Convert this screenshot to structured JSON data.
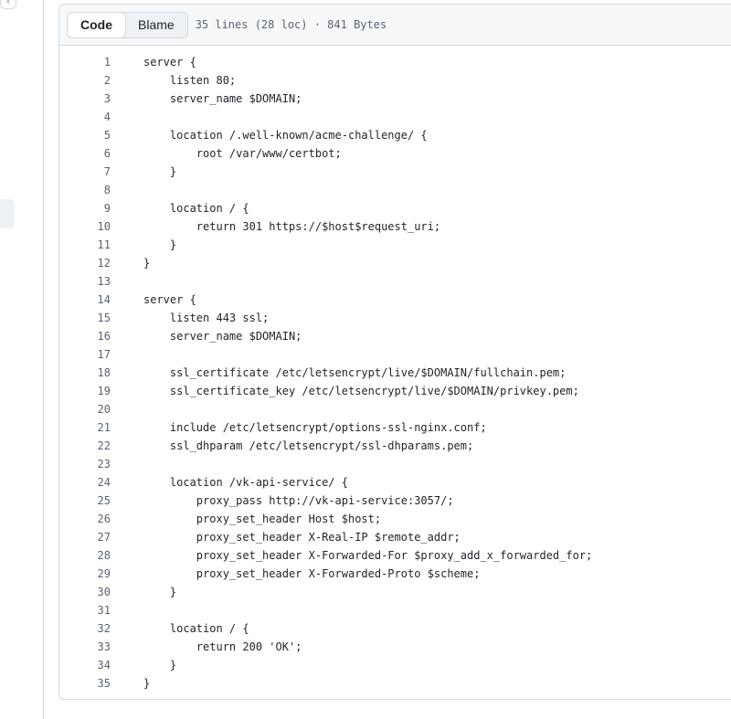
{
  "toolbar": {
    "code_label": "Code",
    "blame_label": "Blame",
    "file_info": "35 lines (28 loc) · 841 Bytes"
  },
  "code": {
    "lines": [
      {
        "num": "1",
        "text": "server {"
      },
      {
        "num": "2",
        "text": "    listen 80;"
      },
      {
        "num": "3",
        "text": "    server_name $DOMAIN;"
      },
      {
        "num": "4",
        "text": ""
      },
      {
        "num": "5",
        "text": "    location /.well-known/acme-challenge/ {"
      },
      {
        "num": "6",
        "text": "        root /var/www/certbot;"
      },
      {
        "num": "7",
        "text": "    }"
      },
      {
        "num": "8",
        "text": ""
      },
      {
        "num": "9",
        "text": "    location / {"
      },
      {
        "num": "10",
        "text": "        return 301 https://$host$request_uri;"
      },
      {
        "num": "11",
        "text": "    }"
      },
      {
        "num": "12",
        "text": "}"
      },
      {
        "num": "13",
        "text": ""
      },
      {
        "num": "14",
        "text": "server {"
      },
      {
        "num": "15",
        "text": "    listen 443 ssl;"
      },
      {
        "num": "16",
        "text": "    server_name $DOMAIN;"
      },
      {
        "num": "17",
        "text": ""
      },
      {
        "num": "18",
        "text": "    ssl_certificate /etc/letsencrypt/live/$DOMAIN/fullchain.pem;"
      },
      {
        "num": "19",
        "text": "    ssl_certificate_key /etc/letsencrypt/live/$DOMAIN/privkey.pem;"
      },
      {
        "num": "20",
        "text": ""
      },
      {
        "num": "21",
        "text": "    include /etc/letsencrypt/options-ssl-nginx.conf;"
      },
      {
        "num": "22",
        "text": "    ssl_dhparam /etc/letsencrypt/ssl-dhparams.pem;"
      },
      {
        "num": "23",
        "text": ""
      },
      {
        "num": "24",
        "text": "    location /vk-api-service/ {"
      },
      {
        "num": "25",
        "text": "        proxy_pass http://vk-api-service:3057/;"
      },
      {
        "num": "26",
        "text": "        proxy_set_header Host $host;"
      },
      {
        "num": "27",
        "text": "        proxy_set_header X-Real-IP $remote_addr;"
      },
      {
        "num": "28",
        "text": "        proxy_set_header X-Forwarded-For $proxy_add_x_forwarded_for;"
      },
      {
        "num": "29",
        "text": "        proxy_set_header X-Forwarded-Proto $scheme;"
      },
      {
        "num": "30",
        "text": "    }"
      },
      {
        "num": "31",
        "text": ""
      },
      {
        "num": "32",
        "text": "    location / {"
      },
      {
        "num": "33",
        "text": "        return 200 'OK';"
      },
      {
        "num": "34",
        "text": "    }"
      },
      {
        "num": "35",
        "text": "}"
      }
    ]
  }
}
